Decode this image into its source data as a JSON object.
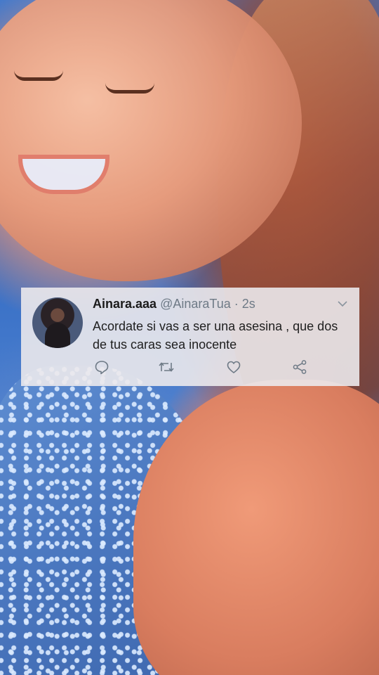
{
  "tweet": {
    "display_name": "Ainara.aaa",
    "handle": "@AinaraTua",
    "separator": "·",
    "time": "2s",
    "text": "Acordate si vas a ser una asesina , que dos de tus caras sea inocente",
    "icons": {
      "menu": "chevron-down-icon",
      "reply": "reply-icon",
      "retweet": "retweet-icon",
      "like": "heart-icon",
      "share": "share-icon"
    },
    "colors": {
      "name": "#1b1b1b",
      "secondary": "#6e7a86",
      "card_background": "#ebe9ec"
    }
  }
}
